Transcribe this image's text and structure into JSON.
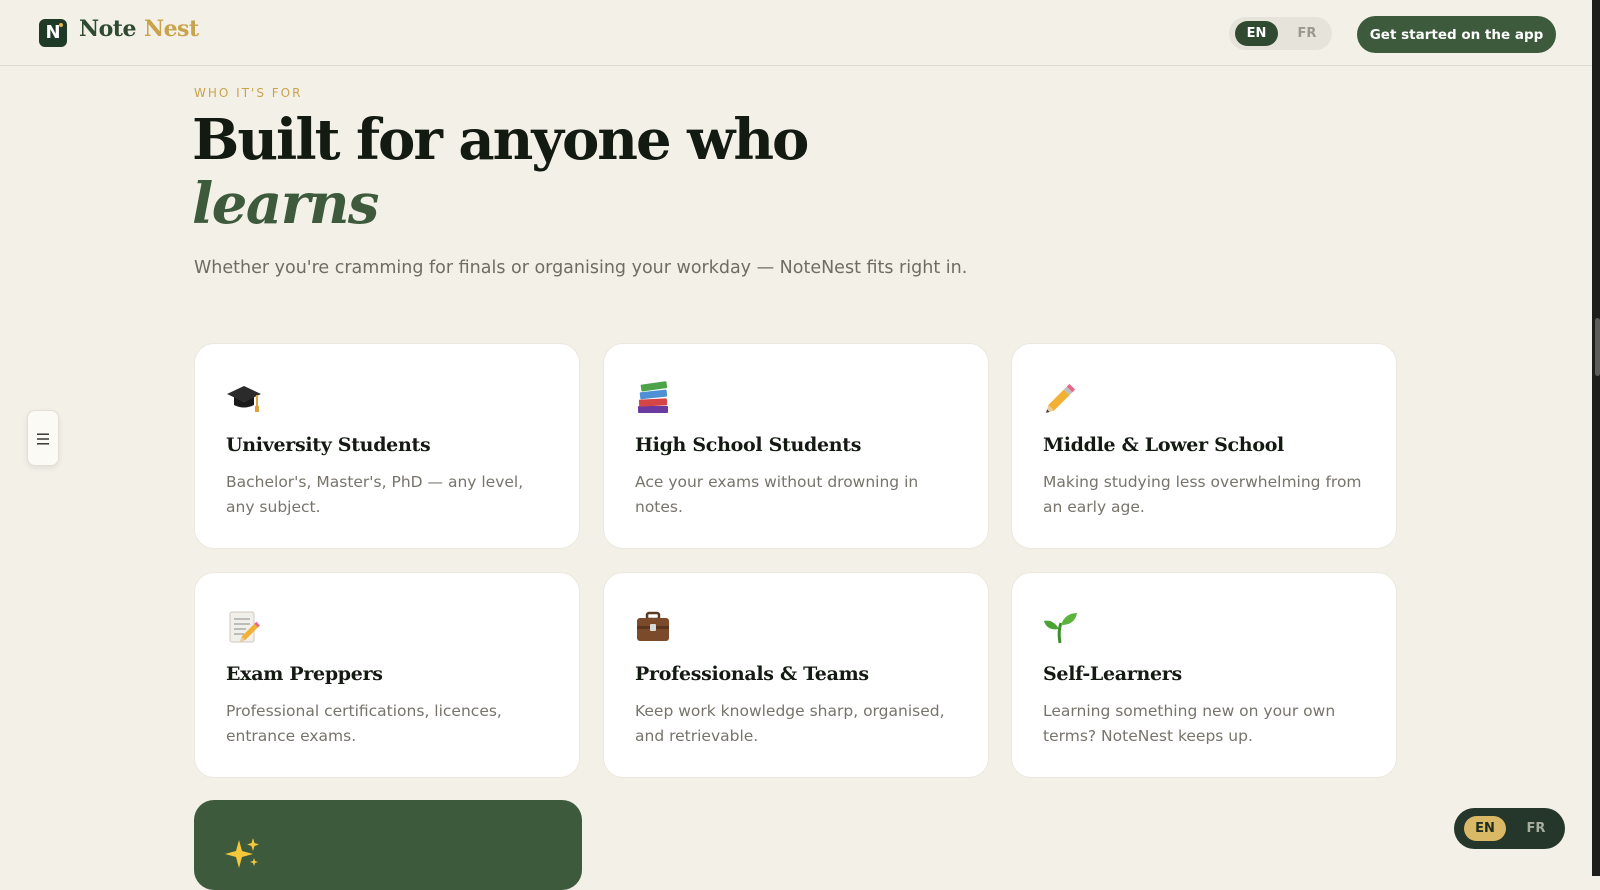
{
  "nav": {
    "logo_letter": "N",
    "logo_word_1": "Note",
    "logo_word_2": "Nest",
    "lang_active": "EN",
    "lang_inactive": "FR",
    "cta_label": "Get started on the app"
  },
  "hero": {
    "eyebrow": "WHO IT'S FOR",
    "title": "Built for anyone who",
    "title_emphasis": "learns",
    "subtitle": "Whether you're cramming for finals or organising your workday — NoteNest fits right in."
  },
  "cards": [
    {
      "icon": "graduation-cap-icon",
      "title": "University Students",
      "desc": "Bachelor's, Master's, PhD — any level, any subject."
    },
    {
      "icon": "books-icon",
      "title": "High School Students",
      "desc": "Ace your exams without drowning in notes."
    },
    {
      "icon": "pencil-icon",
      "title": "Middle & Lower School",
      "desc": "Making studying less overwhelming from an early age."
    },
    {
      "icon": "memo-icon",
      "title": "Exam Preppers",
      "desc": "Professional certifications, licences, entrance exams."
    },
    {
      "icon": "briefcase-icon",
      "title": "Professionals & Teams",
      "desc": "Keep work knowledge sharp, organised, and retrievable."
    },
    {
      "icon": "seedling-icon",
      "title": "Self-Learners",
      "desc": "Learning something new on your own terms? NoteNest keeps up."
    }
  ],
  "dark_card": {
    "icon": "sparkles-icon"
  },
  "side_menu": {
    "icon": "menu-icon"
  },
  "floating_lang": {
    "active": "EN",
    "inactive": "FR"
  },
  "colors": {
    "background": "#f3f0e7",
    "brand_green": "#3d5a3c",
    "gold": "#c9a34c",
    "card_bg": "#ffffff"
  }
}
